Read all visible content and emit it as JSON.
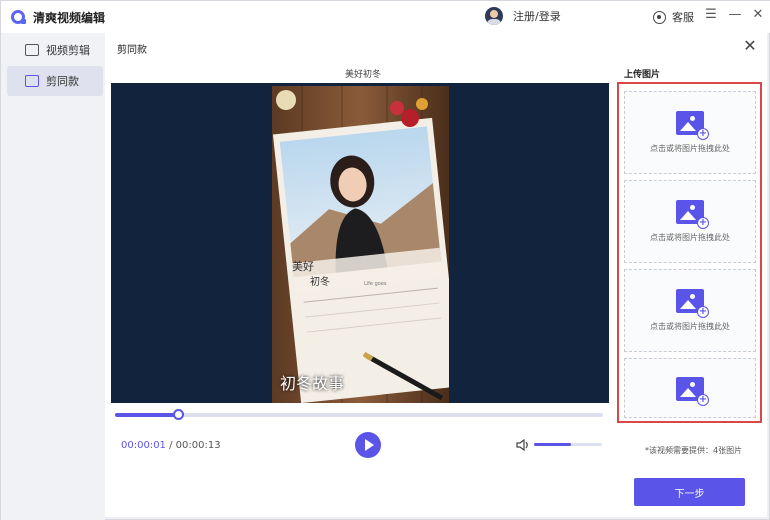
{
  "app": {
    "title": "清爽视频编辑"
  },
  "header": {
    "login": "注册/登录",
    "service": "客服"
  },
  "sidebar": {
    "items": [
      {
        "label": "视频剪辑"
      },
      {
        "label": "剪同款"
      }
    ]
  },
  "dialog": {
    "title": "剪同款",
    "preview_title": "美好初冬",
    "video": {
      "caption_main": "美好",
      "caption_main2": "初冬",
      "caption_small": "Life goes",
      "overlay_title": "初冬故事"
    },
    "upload": {
      "title": "上传图片",
      "boxes": [
        {
          "text": "点击或将图片拖拽此处"
        },
        {
          "text": "点击或将图片拖拽此处"
        },
        {
          "text": "点击或将图片拖拽此处"
        },
        {
          "text": ""
        }
      ],
      "note": "*该视频需要提供：4张图片",
      "next": "下一步"
    },
    "player": {
      "current": "00:00:01",
      "separator": " / ",
      "total": "00:00:13",
      "progress": 0.13,
      "volume": 0.55
    }
  },
  "colors": {
    "accent": "#5a54e8",
    "player_bg": "#12233e",
    "highlight_border": "#d94848"
  }
}
